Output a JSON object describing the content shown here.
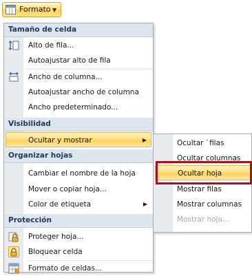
{
  "ribbon": {
    "format_label": "Formato",
    "format_icon": "cell-format-icon",
    "chevron": "chevron-down-icon"
  },
  "menu": {
    "headers": {
      "cell_size": "Tamaño de celda",
      "visibility": "Visibilidad",
      "organize_sheets": "Organizar hojas",
      "protection": "Protección"
    },
    "items": {
      "row_height": "Alto de fila...",
      "autofit_row_height": "Autoajustar alto de fila",
      "column_width": "Ancho de columna...",
      "autofit_column_width": "Autoajustar ancho de columna",
      "default_width": "Ancho predeterminado...",
      "hide_unhide": "Ocultar y mostrar",
      "rename_sheet": "Cambiar el nombre de la hoja",
      "move_copy_sheet": "Mover o copiar hoja...",
      "tab_color": "Color de etiqueta",
      "protect_sheet": "Proteger hoja...",
      "lock_cell": "Bloquear celda",
      "format_cells": "Formato de celdas..."
    },
    "icons": {
      "row_height": "row-height-icon",
      "column_width": "column-width-icon",
      "protect_sheet": "padlock-sheet-icon",
      "lock_cell": "padlock-icon",
      "format_cells": "format-cells-icon",
      "submenu_arrow": "chevron-right-icon"
    }
  },
  "submenu": {
    "items": [
      {
        "label": "Ocultar `filas",
        "state": "normal"
      },
      {
        "label": "Ocultar columnas",
        "state": "normal"
      },
      {
        "label": "Ocultar hoja",
        "state": "highlighted"
      },
      {
        "label": "Mostrar filas",
        "state": "normal"
      },
      {
        "label": "Mostrar columnas",
        "state": "normal"
      },
      {
        "label": "Mostrar hoja...",
        "state": "disabled"
      }
    ]
  },
  "colors": {
    "highlight": "#ffd35a",
    "header_bg": "#dde6ef",
    "annotation": "#a7101c",
    "disabled_text": "#a7abb0"
  }
}
